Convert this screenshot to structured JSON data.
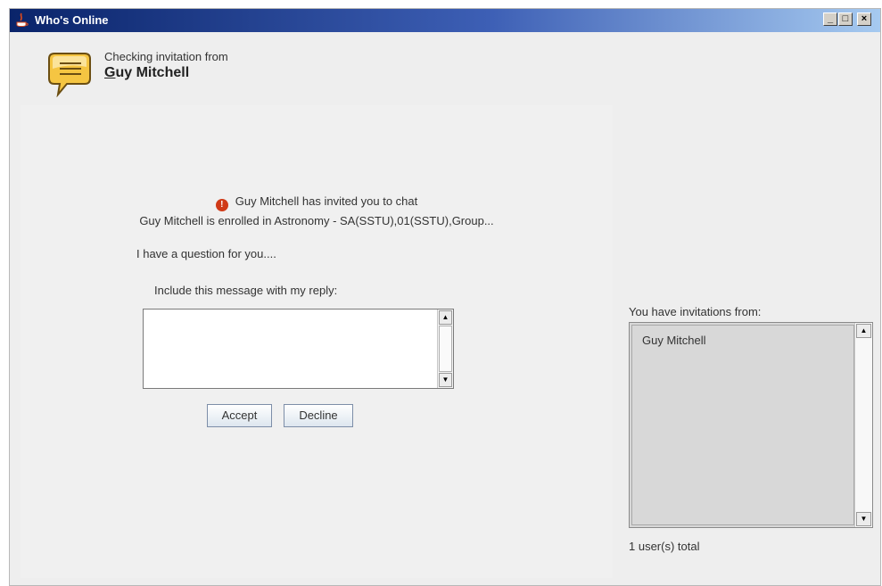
{
  "window": {
    "title": "Who's Online"
  },
  "header": {
    "checking_text": "Checking invitation from",
    "sender_first_letter": "G",
    "sender_rest": "uy Mitchell"
  },
  "invite": {
    "message": "Guy Mitchell has invited you to chat",
    "enrollment": "Guy Mitchell is enrolled in Astronomy - SA(SSTU),01(SSTU),Group...",
    "question": "I have a question for you....",
    "include_label": "Include this message with my reply:",
    "reply_value": "",
    "accept_label": "Accept",
    "decline_label": "Decline"
  },
  "invitations": {
    "label": "You have invitations from:",
    "items": [
      "Guy Mitchell"
    ],
    "total": "1 user(s) total"
  },
  "colors": {
    "titlebar_start": "#0a246a",
    "titlebar_end": "#a6caf0",
    "warning": "#d03a17",
    "bubble": "#f5c542"
  },
  "icons": {
    "title": "java-icon",
    "bubble": "chat-bubble-icon",
    "warning": "warning-icon"
  }
}
